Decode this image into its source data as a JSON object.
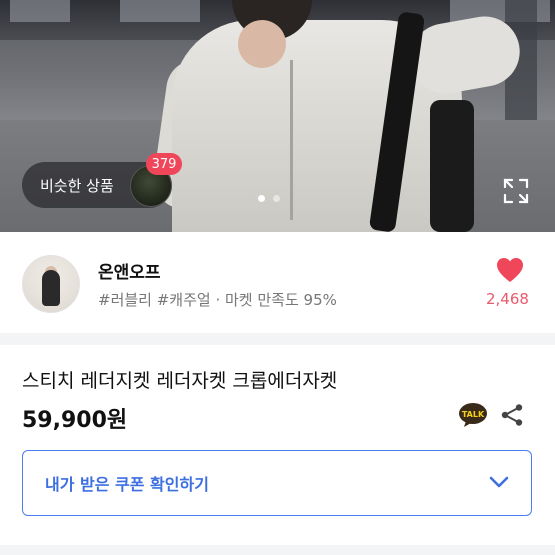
{
  "hero": {
    "similar_label": "비슷한 상품",
    "similar_count": "379",
    "carousel": {
      "total": 2,
      "active": 1
    },
    "expand_icon": "expand-icon"
  },
  "seller": {
    "name": "온앤오프",
    "tags": "#러블리 #캐주얼 · 마켓 만족도 95%",
    "likes": "2,468",
    "like_color": "#ea5a6c"
  },
  "product": {
    "title": "스티치 레더지켓 레더자켓 크롭에더자켓",
    "price": "59,900원"
  },
  "actions": {
    "talk_label": "TALK",
    "share_icon": "share-icon"
  },
  "coupon": {
    "label": "내가 받은 쿠폰 확인하기",
    "accent": "#3d6fe0"
  }
}
